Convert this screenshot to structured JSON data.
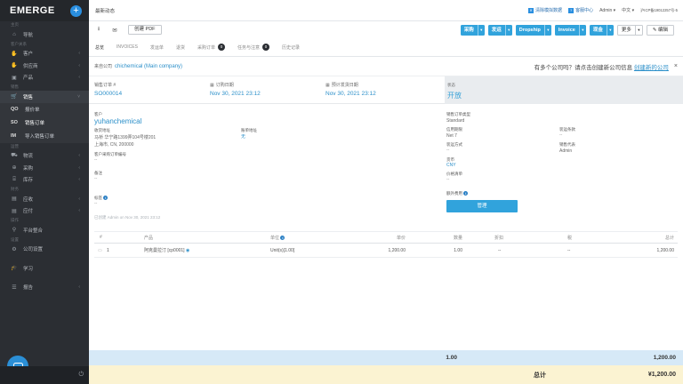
{
  "app": {
    "logo": "EMERGE",
    "plus": "+"
  },
  "sidebar": {
    "sections": {
      "s1": "主页",
      "s2": "客户关系",
      "s3": "销售",
      "s4": "运营",
      "s5": "财务",
      "s6": "操作",
      "s7": "设置"
    },
    "items": {
      "nav": "导航",
      "customers": "客户",
      "suppliers": "供应商",
      "products": "产品",
      "sales": "销售",
      "logistics": "物流",
      "purchasing": "采购",
      "inventory": "库存",
      "receivables": "应收",
      "payables": "应付",
      "platform": "平台整合",
      "company": "公司设置",
      "learning": "学习",
      "reports": "报告"
    },
    "sub": [
      {
        "tag": "QO",
        "label": "报价单"
      },
      {
        "tag": "SO",
        "label": "销售订单"
      },
      {
        "tag": "IM",
        "label": "导入销售订单"
      }
    ]
  },
  "topbar": {
    "news": "最新动态",
    "clear_demo": "清除模拟数据",
    "help": "客服中心",
    "admin": "Admin",
    "lang": "中文",
    "icp": "沪ICP备19012257号-5"
  },
  "toolbar": {
    "create_pdf": "创建 PDF",
    "purchase": "采购",
    "ship": "发运",
    "dropship": "Dropship",
    "invoice": "Invoice",
    "cash": "现金",
    "more": "更多",
    "edit": "编辑"
  },
  "tabs": {
    "overview": "总览",
    "invoices": "INVOICES",
    "ship_orders": "发运单",
    "returns": "退货",
    "purchase_orders": "采购订单",
    "po_count": "0",
    "tasks": "任务与注意",
    "task_count": "0",
    "history": "历史记录"
  },
  "company": {
    "label": "来自公司",
    "name": "chichemical (Main company)",
    "hint": "有多个公司吗？请点击创建新公司信息",
    "hint_link": "创建新的公司",
    "close": "×"
  },
  "header": {
    "order_no_label": "销售订单 #",
    "order_no": "SO000014",
    "order_date_label": "订购日期",
    "order_date": "Nov 30, 2021 23:12",
    "eta_label": "预计发货日期",
    "eta": "Nov 30, 2021 23:12",
    "status_label": "状态",
    "status": "开放"
  },
  "details": {
    "customer_label": "客户",
    "customer": "yuhanchemical",
    "ship_addr_label": "收货地址",
    "ship_addr_line1": "马桥 华宁路1399弄104号楼201",
    "ship_addr_line2": "上海市, CN, 200000",
    "bill_addr_label": "账单地址",
    "bill_addr": "无",
    "cust_po_label": "客户采购订单编号",
    "cust_po": "--",
    "notes_label": "备注",
    "notes": "--",
    "tags_label": "标签",
    "tags": "--",
    "created": "已创建 Admin on Nov 30, 2021 23:12",
    "order_type_label": "销售订单类型",
    "order_type": "Standard",
    "payment_term_label": "信用期限",
    "payment_term": "Net 7",
    "delivery_terms_label": "装运条款",
    "delivery_terms": "--",
    "ship_method_label": "装运方式",
    "ship_method": "--",
    "rep_label": "销售代表",
    "rep": "Admin",
    "currency_label": "货币",
    "currency": "CNY",
    "price_list_label": "价格清单",
    "price_list": "--",
    "extra_fee_label": "额外费用",
    "manage": "管理"
  },
  "table": {
    "headers": {
      "num": "#",
      "product": "产品",
      "unit": "单位",
      "price": "单价",
      "qty": "数量",
      "discount": "折扣",
      "tax": "税",
      "total": "总计"
    },
    "rows": [
      {
        "num": "1",
        "product": "阿克曼拉汀 [cp0001]",
        "unit": "Unit(s)[1.00]",
        "price": "1,200.00",
        "qty": "1.00",
        "discount": "--",
        "tax": "--",
        "total": "1,200.00"
      }
    ]
  },
  "footer": {
    "qty_total": "1.00",
    "amount_total": "1,200.00",
    "total_label": "总计",
    "grand_total": "¥1,200.00"
  },
  "colors": {
    "accent": "#31a3dc",
    "sidebar": "#2b2e33",
    "link": "#2b8fc9",
    "status": "#3aa3d8"
  }
}
